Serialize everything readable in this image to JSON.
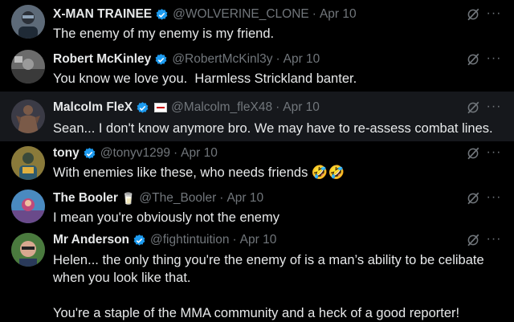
{
  "tweets": [
    {
      "name": "X-MAN TRAINEE",
      "verified": true,
      "handle": "@WOLVERINE_CLONE",
      "separator": "·",
      "time": "Apr 10",
      "text": "The enemy of my enemy is my friend.",
      "more": "···",
      "avatar_color": "#5d6a78"
    },
    {
      "name": "Robert McKinley",
      "verified": true,
      "handle": "@RobertMcKinl3y",
      "separator": "·",
      "time": "Apr 10",
      "text": "You know we love you.  Harmless Strickland banter.",
      "more": "···",
      "avatar_color": "#6b6b6b"
    },
    {
      "name": "Malcolm FleX",
      "verified": true,
      "handle": "@Malcolm_fleX48",
      "separator": "·",
      "time": "Apr 10",
      "text": "Sean... I don't know anymore bro. We may have to re-assess combat lines.",
      "more": "···",
      "avatar_color": "#7a5a48",
      "highlighted": true
    },
    {
      "name": "tony",
      "verified": true,
      "handle": "@tonyv1299",
      "separator": "·",
      "time": "Apr 10",
      "text": "With enemies like these, who needs friends 🤣🤣",
      "more": "···",
      "avatar_color": "#8a7a3a"
    },
    {
      "name": "The Booler",
      "badge_emoji": "🥛",
      "handle": "@The_Booler",
      "separator": "·",
      "time": "Apr 10",
      "text": "I mean you're obviously not the enemy",
      "more": "···",
      "avatar_color": "#c04a7a"
    },
    {
      "name": "Mr Anderson",
      "verified": true,
      "handle": "@fightintuition",
      "separator": "·",
      "time": "Apr 10",
      "text": "Helen... the only thing you're the enemy of is a man’s ability to be celibate\nwhen you look like that.\n\nYou're a staple of the MMA community and a heck of a good reporter!",
      "more": "···",
      "avatar_color": "#4a7a3e"
    }
  ],
  "colors": {
    "background": "#000000",
    "highlight": "#16181c",
    "verified": "#1d9bf0",
    "muted": "#71767b",
    "text": "#e7e9ea"
  },
  "icons": {
    "verified": "verified-badge-icon",
    "grok": "grok-icon",
    "more": "more-options-icon"
  }
}
